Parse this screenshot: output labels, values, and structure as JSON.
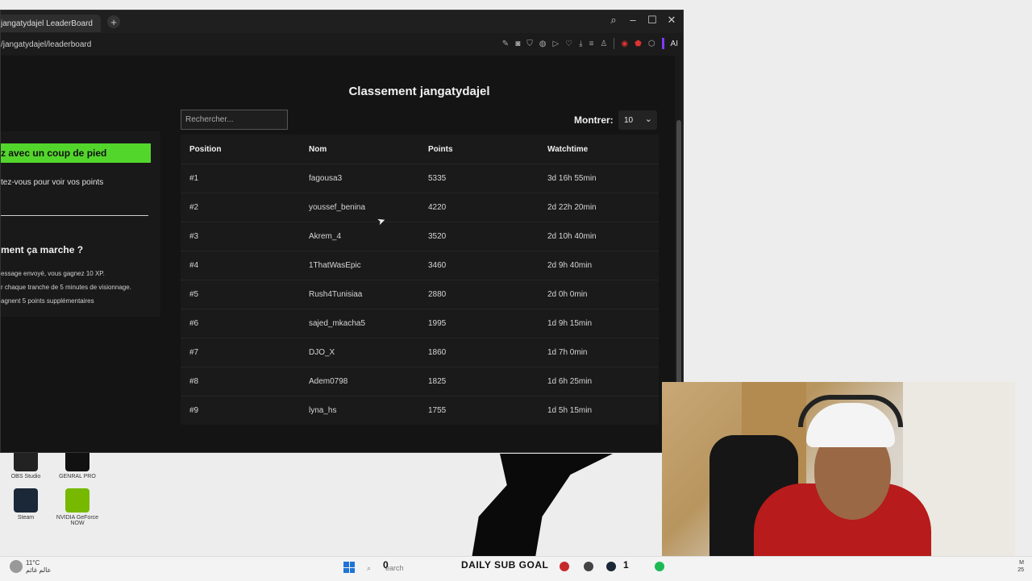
{
  "browser": {
    "tab_title": "jangatydajel LeaderBoard",
    "new_tab_glyph": "+",
    "url": "/jangatydajel/leaderboard",
    "ai_label": "AI"
  },
  "page": {
    "title": "Classement jangatydajel",
    "search_placeholder": "Rechercher...",
    "show_label": "Montrer:",
    "show_value": "10"
  },
  "left_panel": {
    "kick_button": "z avec un coup de pied",
    "connect_text": "tez-vous pour voir vos points",
    "how_title": "ment ça marche ?",
    "how_lines": [
      "essage envoyé, vous gagnez 10 XP.",
      "r chaque tranche de 5 minutes de visionnage.",
      "agnent 5 points supplémentaires"
    ]
  },
  "table": {
    "headers": [
      "Position",
      "Nom",
      "Points",
      "Watchtime"
    ],
    "rows": [
      {
        "pos": "#1",
        "name": "fagousa3",
        "points": "5335",
        "watch": "3d 16h 55min"
      },
      {
        "pos": "#2",
        "name": "youssef_benina",
        "points": "4220",
        "watch": "2d 22h 20min"
      },
      {
        "pos": "#3",
        "name": "Akrem_4",
        "points": "3520",
        "watch": "2d 10h 40min"
      },
      {
        "pos": "#4",
        "name": "1ThatWasEpic",
        "points": "3460",
        "watch": "2d 9h 40min"
      },
      {
        "pos": "#5",
        "name": "Rush4Tunisiaa",
        "points": "2880",
        "watch": "2d 0h 0min"
      },
      {
        "pos": "#6",
        "name": "sajed_mkacha5",
        "points": "1995",
        "watch": "1d 9h 15min"
      },
      {
        "pos": "#7",
        "name": "DJO_X",
        "points": "1860",
        "watch": "1d 7h 0min"
      },
      {
        "pos": "#8",
        "name": "Adem0798",
        "points": "1825",
        "watch": "1d 6h 25min"
      },
      {
        "pos": "#9",
        "name": "lyna_hs",
        "points": "1755",
        "watch": "1d 5h 15min"
      }
    ]
  },
  "desktop": {
    "icons": [
      {
        "label": "OBS Studio"
      },
      {
        "label": "GENRAL PRO"
      },
      {
        "label": "Steam"
      },
      {
        "label": "NVIDIA GeForce NOW"
      }
    ]
  },
  "taskbar": {
    "weather_temp": "11°C",
    "weather_loc": "عالم غائم",
    "search_text": "earch",
    "zero": "0",
    "sub_goal": "DAILY SUB GOAL",
    "one": "1",
    "clock_top": "M",
    "clock_bottom": "25"
  },
  "colors": {
    "kick_green": "#53d62c",
    "page_bg": "#141414",
    "table_bg": "#1a1a1a"
  }
}
